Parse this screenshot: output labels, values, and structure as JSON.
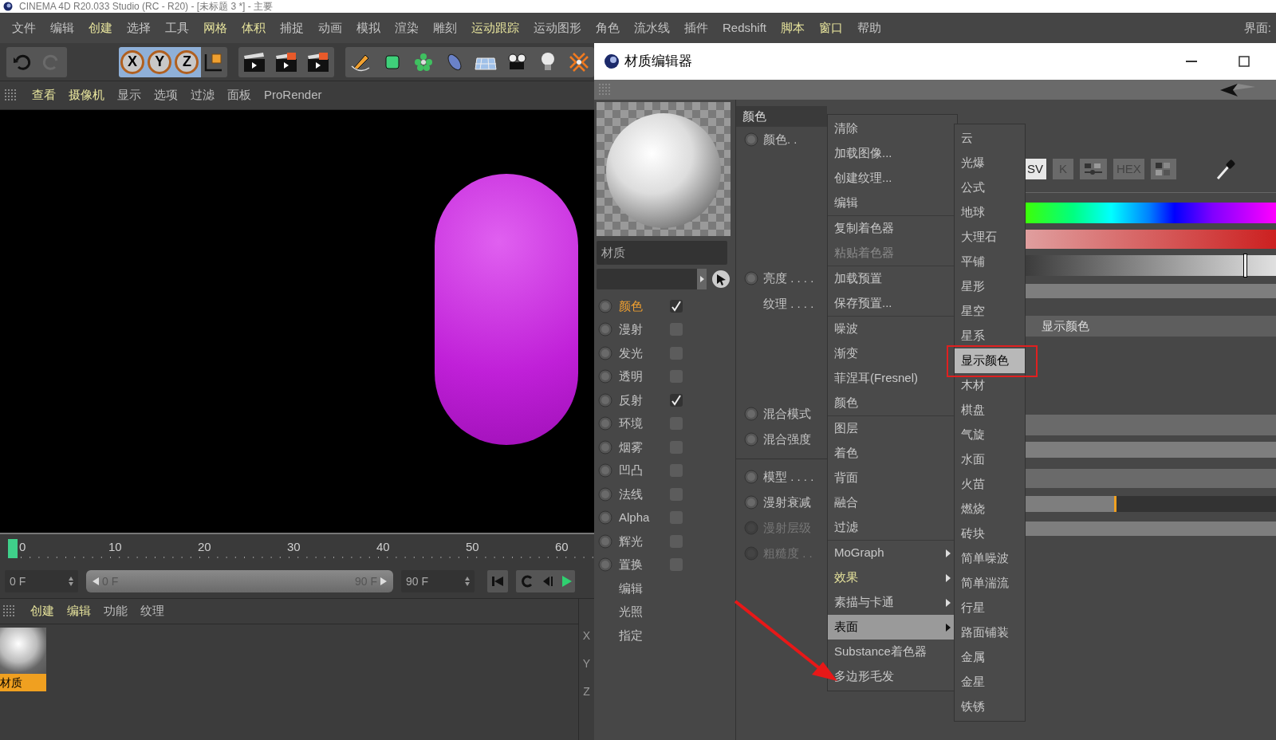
{
  "window": {
    "title": "CINEMA 4D R20.033 Studio (RC - R20) - [未标题 3 *] - 主要"
  },
  "menu_bar": {
    "items": [
      {
        "label": "文件",
        "highlighted": false
      },
      {
        "label": "编辑",
        "highlighted": false
      },
      {
        "label": "创建",
        "highlighted": true
      },
      {
        "label": "选择",
        "highlighted": false
      },
      {
        "label": "工具",
        "highlighted": false
      },
      {
        "label": "网格",
        "highlighted": true
      },
      {
        "label": "体积",
        "highlighted": true
      },
      {
        "label": "捕捉",
        "highlighted": false
      },
      {
        "label": "动画",
        "highlighted": false
      },
      {
        "label": "模拟",
        "highlighted": false
      },
      {
        "label": "渲染",
        "highlighted": false
      },
      {
        "label": "雕刻",
        "highlighted": false
      },
      {
        "label": "运动跟踪",
        "highlighted": true
      },
      {
        "label": "运动图形",
        "highlighted": false
      },
      {
        "label": "角色",
        "highlighted": false
      },
      {
        "label": "流水线",
        "highlighted": false
      },
      {
        "label": "插件",
        "highlighted": false
      },
      {
        "label": "Redshift",
        "highlighted": false
      },
      {
        "label": "脚本",
        "highlighted": true
      },
      {
        "label": "窗口",
        "highlighted": true
      },
      {
        "label": "帮助",
        "highlighted": false
      }
    ],
    "right_label": "界面:"
  },
  "toolbar": {
    "axis_locks": [
      {
        "label": "X",
        "selected": true
      },
      {
        "label": "Y",
        "selected": true
      },
      {
        "label": "Z",
        "selected": true
      }
    ]
  },
  "viewport": {
    "menu": [
      {
        "label": "查看",
        "highlighted": true
      },
      {
        "label": "摄像机",
        "highlighted": true
      },
      {
        "label": "显示",
        "highlighted": false
      },
      {
        "label": "选项",
        "highlighted": false
      },
      {
        "label": "过滤",
        "highlighted": false
      },
      {
        "label": "面板",
        "highlighted": false
      },
      {
        "label": "ProRender",
        "highlighted": false
      }
    ]
  },
  "timeline": {
    "ticks": [
      "0",
      "10",
      "20",
      "30",
      "40",
      "50",
      "60"
    ],
    "start_field": "0 F",
    "range_start": "0 F",
    "range_end": "90 F",
    "end_field": "90 F"
  },
  "material_manager": {
    "menu": [
      {
        "label": "创建",
        "highlighted": true
      },
      {
        "label": "编辑",
        "highlighted": true
      },
      {
        "label": "功能",
        "highlighted": false
      },
      {
        "label": "纹理",
        "highlighted": false
      }
    ],
    "materials": [
      {
        "name": "材质",
        "selected": true
      }
    ]
  },
  "coordinates": {
    "labels": [
      "X",
      "Y",
      "Z"
    ]
  },
  "material_editor": {
    "title": "材质编辑器",
    "material_name": "材质",
    "channels": [
      {
        "label": "颜色",
        "kind": "channel",
        "checked": true,
        "selected": true
      },
      {
        "label": "漫射",
        "kind": "channel",
        "checked": false,
        "selected": false
      },
      {
        "label": "发光",
        "kind": "channel",
        "checked": false,
        "selected": false
      },
      {
        "label": "透明",
        "kind": "channel",
        "checked": false,
        "selected": false
      },
      {
        "label": "反射",
        "kind": "channel",
        "checked": true,
        "selected": false
      },
      {
        "label": "环境",
        "kind": "channel",
        "checked": false,
        "selected": false
      },
      {
        "label": "烟雾",
        "kind": "channel",
        "checked": false,
        "selected": false
      },
      {
        "label": "凹凸",
        "kind": "channel",
        "checked": false,
        "selected": false
      },
      {
        "label": "法线",
        "kind": "channel",
        "checked": false,
        "selected": false
      },
      {
        "label": "Alpha",
        "kind": "channel",
        "checked": false,
        "selected": false
      },
      {
        "label": "辉光",
        "kind": "channel",
        "checked": false,
        "selected": false
      },
      {
        "label": "置换",
        "kind": "channel",
        "checked": false,
        "selected": false
      },
      {
        "label": "编辑",
        "kind": "page",
        "selected": false
      },
      {
        "label": "光照",
        "kind": "page",
        "selected": false
      },
      {
        "label": "指定",
        "kind": "page",
        "selected": false
      }
    ],
    "color_section": {
      "header": "颜色",
      "sections": [
        {
          "rows": [
            {
              "label": "颜色. .",
              "animatable": true,
              "disabled": false
            }
          ]
        },
        {
          "rows": [
            {
              "label": "亮度 . . . .",
              "animatable": true,
              "disabled": false
            },
            {
              "label": "纹理 . . . .",
              "animatable": false,
              "disabled": false
            }
          ]
        },
        {
          "rows": [
            {
              "label": "混合模式",
              "animatable": true,
              "disabled": false
            },
            {
              "label": "混合强度",
              "animatable": true,
              "disabled": false
            }
          ]
        },
        {
          "rows": [
            {
              "label": "模型 . . . .",
              "animatable": true,
              "disabled": false
            },
            {
              "label": "漫射衰减",
              "animatable": true,
              "disabled": false
            },
            {
              "label": "漫射层级",
              "animatable": true,
              "disabled": true
            },
            {
              "label": "粗糙度 . .",
              "animatable": true,
              "disabled": true
            }
          ]
        }
      ]
    },
    "color_picker": {
      "modes": [
        {
          "kind": "text",
          "label": "SV",
          "selected": true
        },
        {
          "kind": "text",
          "label": "K",
          "selected": false
        },
        {
          "kind": "sliders",
          "selected": false
        },
        {
          "kind": "text",
          "label": "HEX",
          "selected": false
        },
        {
          "kind": "swatches",
          "selected": false
        }
      ],
      "brightness": {
        "level": 0.87
      },
      "shader_button": "显示颜色",
      "mix_strength": {
        "level": 0.37
      }
    }
  },
  "context_menu": {
    "groups": [
      [
        {
          "label": "清除",
          "disabled": false,
          "submenu": false,
          "highlighted": false,
          "selected": false
        },
        {
          "label": "加载图像...",
          "disabled": false,
          "submenu": false,
          "highlighted": false,
          "selected": false
        },
        {
          "label": "创建纹理...",
          "disabled": false,
          "submenu": false,
          "highlighted": false,
          "selected": false
        },
        {
          "label": "编辑",
          "disabled": false,
          "submenu": false,
          "highlighted": false,
          "selected": false
        }
      ],
      [
        {
          "label": "复制着色器",
          "disabled": false,
          "submenu": false,
          "highlighted": false,
          "selected": false
        },
        {
          "label": "粘贴着色器",
          "disabled": true,
          "submenu": false,
          "highlighted": false,
          "selected": false
        }
      ],
      [
        {
          "label": "加载预置",
          "disabled": false,
          "submenu": false,
          "highlighted": false,
          "selected": false
        },
        {
          "label": "保存预置...",
          "disabled": false,
          "submenu": false,
          "highlighted": false,
          "selected": false
        }
      ],
      [
        {
          "label": "噪波",
          "disabled": false,
          "submenu": false,
          "highlighted": false,
          "selected": false
        },
        {
          "label": "渐变",
          "disabled": false,
          "submenu": false,
          "highlighted": false,
          "selected": false
        },
        {
          "label": "菲涅耳(Fresnel)",
          "disabled": false,
          "submenu": false,
          "highlighted": false,
          "selected": false
        },
        {
          "label": "颜色",
          "disabled": false,
          "submenu": false,
          "highlighted": false,
          "selected": false
        }
      ],
      [
        {
          "label": "图层",
          "disabled": false,
          "submenu": false,
          "highlighted": false,
          "selected": false
        },
        {
          "label": "着色",
          "disabled": false,
          "submenu": false,
          "highlighted": false,
          "selected": false
        },
        {
          "label": "背面",
          "disabled": false,
          "submenu": false,
          "highlighted": false,
          "selected": false
        },
        {
          "label": "融合",
          "disabled": false,
          "submenu": false,
          "highlighted": false,
          "selected": false
        },
        {
          "label": "过滤",
          "disabled": false,
          "submenu": false,
          "highlighted": false,
          "selected": false
        }
      ],
      [
        {
          "label": "MoGraph",
          "disabled": false,
          "submenu": true,
          "highlighted": false,
          "selected": false
        },
        {
          "label": "效果",
          "disabled": false,
          "submenu": true,
          "highlighted": true,
          "selected": false
        },
        {
          "label": "素描与卡通",
          "disabled": false,
          "submenu": true,
          "highlighted": false,
          "selected": false
        },
        {
          "label": "表面",
          "disabled": false,
          "submenu": true,
          "highlighted": false,
          "selected": true
        },
        {
          "label": "Substance着色器",
          "disabled": false,
          "submenu": false,
          "highlighted": false,
          "selected": false
        },
        {
          "label": "多边形毛发",
          "disabled": false,
          "submenu": false,
          "highlighted": false,
          "selected": false
        }
      ]
    ]
  },
  "submenu": {
    "items": [
      {
        "label": "云",
        "selected": false
      },
      {
        "label": "光爆",
        "selected": false
      },
      {
        "label": "公式",
        "selected": false
      },
      {
        "label": "地球",
        "selected": false
      },
      {
        "label": "大理石",
        "selected": false
      },
      {
        "label": "平铺",
        "selected": false
      },
      {
        "label": "星形",
        "selected": false
      },
      {
        "label": "星空",
        "selected": false
      },
      {
        "label": "星系",
        "selected": false
      },
      {
        "label": "显示颜色",
        "selected": true
      },
      {
        "label": "木材",
        "selected": false
      },
      {
        "label": "棋盘",
        "selected": false
      },
      {
        "label": "气旋",
        "selected": false
      },
      {
        "label": "水面",
        "selected": false
      },
      {
        "label": "火苗",
        "selected": false
      },
      {
        "label": "燃烧",
        "selected": false
      },
      {
        "label": "砖块",
        "selected": false
      },
      {
        "label": "简单噪波",
        "selected": false
      },
      {
        "label": "简单湍流",
        "selected": false
      },
      {
        "label": "行星",
        "selected": false
      },
      {
        "label": "路面铺装",
        "selected": false
      },
      {
        "label": "金属",
        "selected": false
      },
      {
        "label": "金星",
        "selected": false
      },
      {
        "label": "铁锈",
        "selected": false
      }
    ]
  }
}
